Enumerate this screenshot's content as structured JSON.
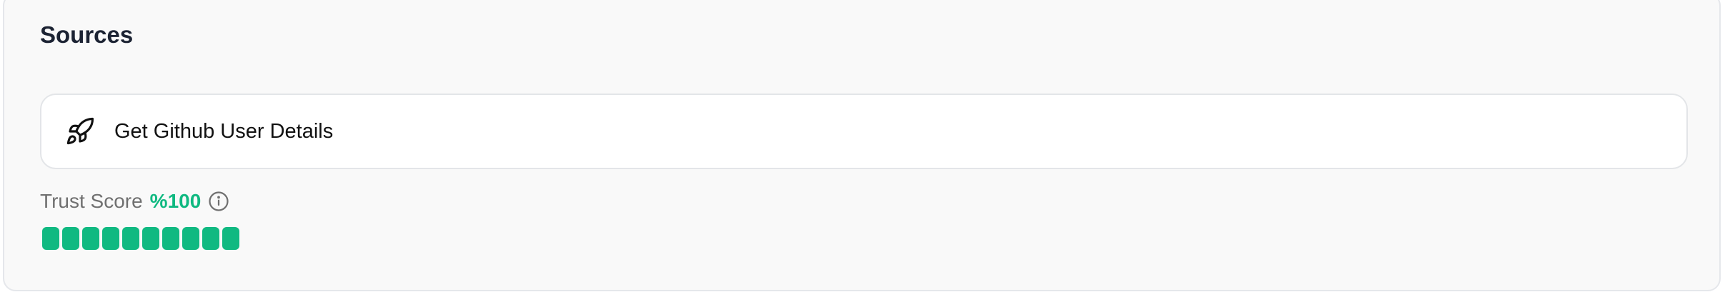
{
  "sources": {
    "title": "Sources",
    "items": [
      {
        "label": "Get Github User Details",
        "icon": "rocket-icon"
      }
    ]
  },
  "trust": {
    "label": "Trust Score",
    "value": "%100",
    "percent": 100,
    "segments_total": 10,
    "segments_filled": 10,
    "info_icon": "info-icon",
    "color": "#10b981"
  }
}
